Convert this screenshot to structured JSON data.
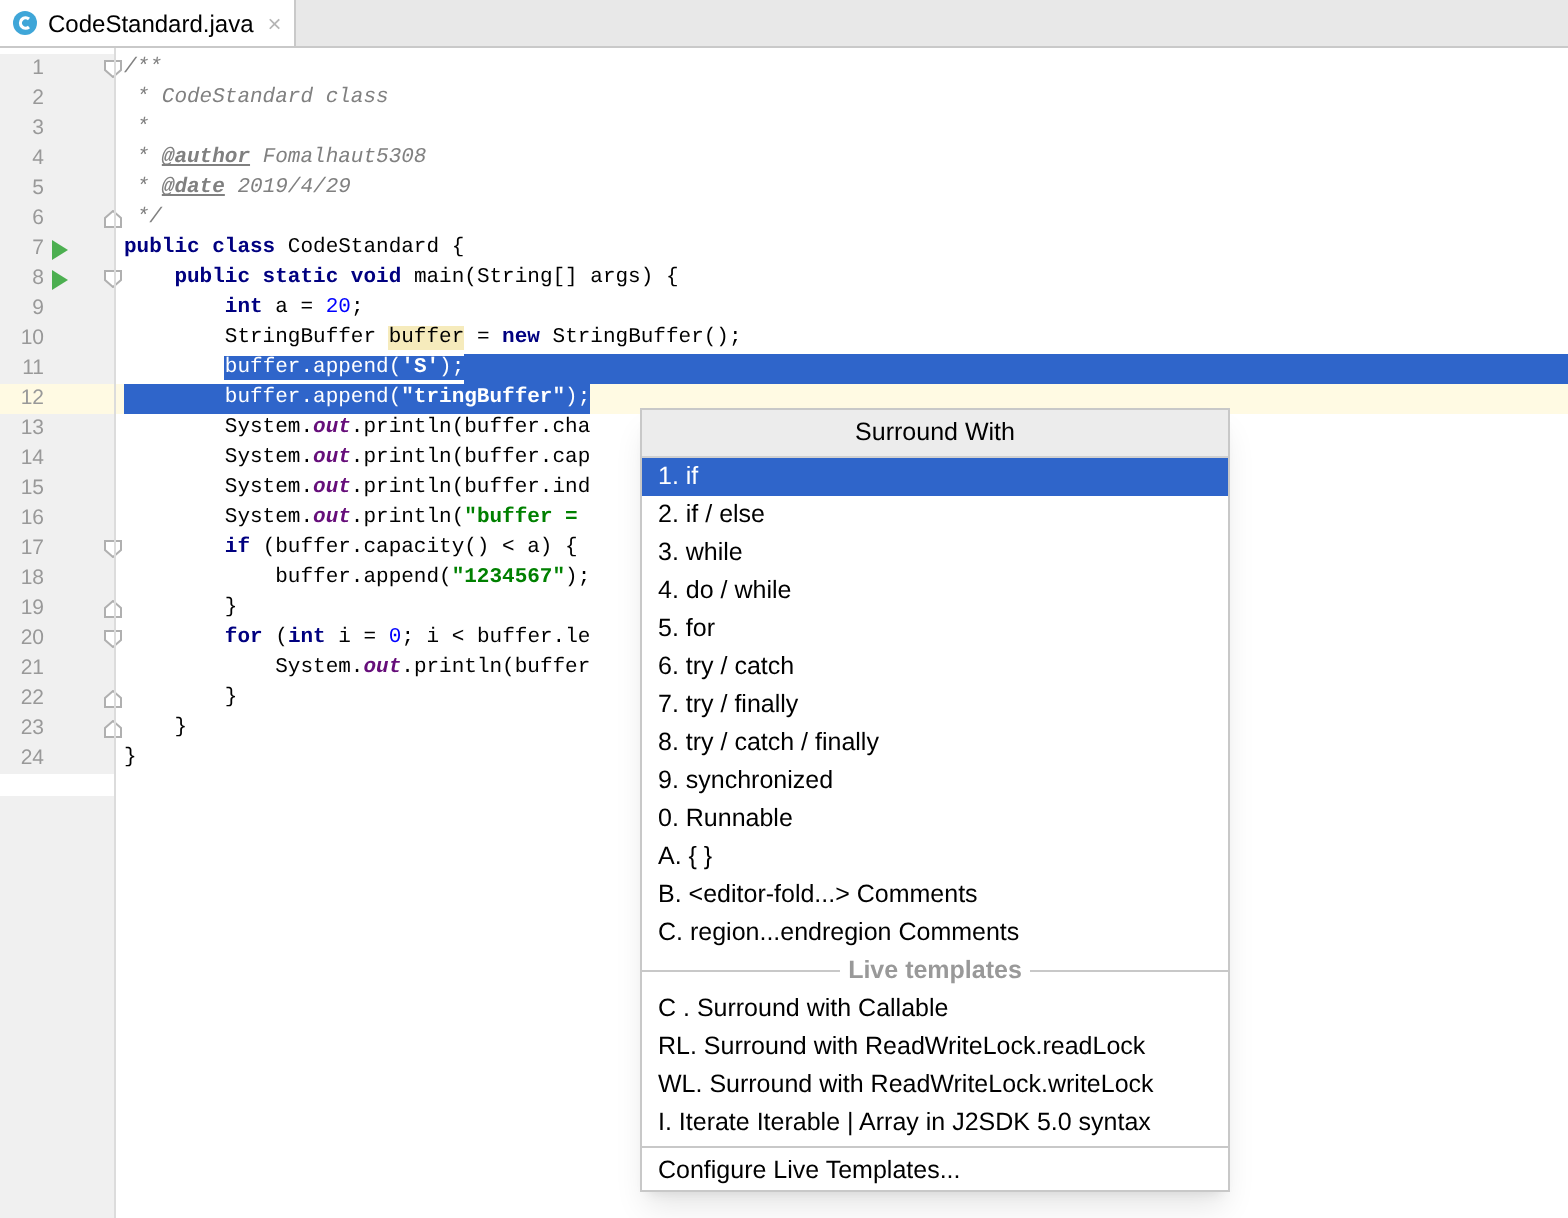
{
  "tabs": [
    {
      "label": "CodeStandard.java",
      "selected": true,
      "close": "×"
    }
  ],
  "lines": [
    {
      "n": "1",
      "run": false,
      "fold_start": true,
      "fold_end": false,
      "selected": false,
      "current": false,
      "tokens": [
        {
          "t": "/**",
          "kind": "comment"
        }
      ]
    },
    {
      "n": "2",
      "run": false,
      "fold_start": false,
      "fold_end": false,
      "selected": false,
      "current": false,
      "tokens": [
        {
          "t": " * CodeStandard class",
          "kind": "comment"
        }
      ]
    },
    {
      "n": "3",
      "run": false,
      "fold_start": false,
      "fold_end": false,
      "selected": false,
      "current": false,
      "tokens": [
        {
          "t": " *",
          "kind": "comment"
        }
      ]
    },
    {
      "n": "4",
      "run": false,
      "fold_start": false,
      "fold_end": false,
      "selected": false,
      "current": false,
      "tokens": [
        {
          "t": " * ",
          "kind": "comment"
        },
        {
          "t": "@author",
          "kind": "tag"
        },
        {
          "t": " Fomalhaut5308",
          "kind": "comment"
        }
      ]
    },
    {
      "n": "5",
      "run": false,
      "fold_start": false,
      "fold_end": false,
      "selected": false,
      "current": false,
      "tokens": [
        {
          "t": " * ",
          "kind": "comment"
        },
        {
          "t": "@date",
          "kind": "tag"
        },
        {
          "t": " 2019/4/29",
          "kind": "comment"
        }
      ]
    },
    {
      "n": "6",
      "run": false,
      "fold_start": false,
      "fold_end": true,
      "selected": false,
      "current": false,
      "tokens": [
        {
          "t": " */",
          "kind": "comment"
        }
      ]
    },
    {
      "n": "7",
      "run": true,
      "fold_start": false,
      "fold_end": false,
      "selected": false,
      "current": false,
      "tokens": [
        {
          "t": "public class ",
          "kind": "keyword"
        },
        {
          "t": "CodeStandard {",
          "kind": "plain"
        }
      ]
    },
    {
      "n": "8",
      "run": true,
      "fold_start": true,
      "fold_end": false,
      "selected": false,
      "current": false,
      "tokens": [
        {
          "t": "    public static void ",
          "kind": "keyword"
        },
        {
          "t": "main(String[] args) {",
          "kind": "plain"
        }
      ]
    },
    {
      "n": "9",
      "run": false,
      "fold_start": false,
      "fold_end": false,
      "selected": false,
      "current": false,
      "tokens": [
        {
          "t": "        int ",
          "kind": "keyword"
        },
        {
          "t": "a = ",
          "kind": "plain"
        },
        {
          "t": "20",
          "kind": "number"
        },
        {
          "t": ";",
          "kind": "plain"
        }
      ]
    },
    {
      "n": "10",
      "run": false,
      "fold_start": false,
      "fold_end": false,
      "selected": false,
      "current": false,
      "tokens": [
        {
          "t": "        StringBuffer ",
          "kind": "plain"
        },
        {
          "t": "buffer",
          "kind": "highlight"
        },
        {
          "t": " = ",
          "kind": "plain"
        },
        {
          "t": "new ",
          "kind": "keyword"
        },
        {
          "t": "StringBuffer();",
          "kind": "plain"
        }
      ]
    },
    {
      "n": "11",
      "run": false,
      "fold_start": false,
      "fold_end": false,
      "selected": true,
      "current": false,
      "tokens": [
        {
          "t": "        buffer.append(",
          "kind": "plain"
        },
        {
          "t": "'S'",
          "kind": "string"
        },
        {
          "t": ");",
          "kind": "plain"
        }
      ]
    },
    {
      "n": "12",
      "run": false,
      "fold_start": false,
      "fold_end": false,
      "selected": true,
      "current": true,
      "tokens": [
        {
          "t": "        buffer.append(",
          "kind": "plain"
        },
        {
          "t": "\"tringBuffer\"",
          "kind": "string"
        },
        {
          "t": ");",
          "kind": "plain"
        }
      ]
    },
    {
      "n": "13",
      "run": false,
      "fold_start": false,
      "fold_end": false,
      "selected": false,
      "current": false,
      "tokens": [
        {
          "t": "        System.",
          "kind": "plain"
        },
        {
          "t": "out",
          "kind": "field"
        },
        {
          "t": ".println(buffer.cha",
          "kind": "plain"
        }
      ]
    },
    {
      "n": "14",
      "run": false,
      "fold_start": false,
      "fold_end": false,
      "selected": false,
      "current": false,
      "tokens": [
        {
          "t": "        System.",
          "kind": "plain"
        },
        {
          "t": "out",
          "kind": "field"
        },
        {
          "t": ".println(buffer.cap",
          "kind": "plain"
        }
      ]
    },
    {
      "n": "15",
      "run": false,
      "fold_start": false,
      "fold_end": false,
      "selected": false,
      "current": false,
      "tokens": [
        {
          "t": "        System.",
          "kind": "plain"
        },
        {
          "t": "out",
          "kind": "field"
        },
        {
          "t": ".println(buffer.ind",
          "kind": "plain"
        }
      ]
    },
    {
      "n": "16",
      "run": false,
      "fold_start": false,
      "fold_end": false,
      "selected": false,
      "current": false,
      "tokens": [
        {
          "t": "        System.",
          "kind": "plain"
        },
        {
          "t": "out",
          "kind": "field"
        },
        {
          "t": ".println(",
          "kind": "plain"
        },
        {
          "t": "\"buffer =",
          "kind": "string"
        }
      ]
    },
    {
      "n": "17",
      "run": false,
      "fold_start": true,
      "fold_end": false,
      "selected": false,
      "current": false,
      "tokens": [
        {
          "t": "        if ",
          "kind": "keyword"
        },
        {
          "t": "(buffer.capacity() < a) {",
          "kind": "plain"
        }
      ]
    },
    {
      "n": "18",
      "run": false,
      "fold_start": false,
      "fold_end": false,
      "selected": false,
      "current": false,
      "tokens": [
        {
          "t": "            buffer.append(",
          "kind": "plain"
        },
        {
          "t": "\"1234567\"",
          "kind": "string"
        },
        {
          "t": ");",
          "kind": "plain"
        }
      ]
    },
    {
      "n": "19",
      "run": false,
      "fold_start": false,
      "fold_end": true,
      "selected": false,
      "current": false,
      "tokens": [
        {
          "t": "        }",
          "kind": "plain"
        }
      ]
    },
    {
      "n": "20",
      "run": false,
      "fold_start": true,
      "fold_end": false,
      "selected": false,
      "current": false,
      "tokens": [
        {
          "t": "        for ",
          "kind": "keyword"
        },
        {
          "t": "(",
          "kind": "plain"
        },
        {
          "t": "int ",
          "kind": "keyword"
        },
        {
          "t": "i = ",
          "kind": "plain"
        },
        {
          "t": "0",
          "kind": "number"
        },
        {
          "t": "; i < buffer.le",
          "kind": "plain"
        }
      ]
    },
    {
      "n": "21",
      "run": false,
      "fold_start": false,
      "fold_end": false,
      "selected": false,
      "current": false,
      "tokens": [
        {
          "t": "            System.",
          "kind": "plain"
        },
        {
          "t": "out",
          "kind": "field"
        },
        {
          "t": ".println(buffer",
          "kind": "plain"
        }
      ]
    },
    {
      "n": "22",
      "run": false,
      "fold_start": false,
      "fold_end": true,
      "selected": false,
      "current": false,
      "tokens": [
        {
          "t": "        }",
          "kind": "plain"
        }
      ]
    },
    {
      "n": "23",
      "run": false,
      "fold_start": false,
      "fold_end": true,
      "selected": false,
      "current": false,
      "tokens": [
        {
          "t": "    }",
          "kind": "plain"
        }
      ]
    },
    {
      "n": "24",
      "run": false,
      "fold_start": false,
      "fold_end": false,
      "selected": false,
      "current": false,
      "tokens": [
        {
          "t": "}",
          "kind": "plain"
        }
      ]
    }
  ],
  "popup": {
    "title": "Surround With",
    "items": [
      {
        "kind": "item",
        "label": "1. if",
        "selected": true
      },
      {
        "kind": "item",
        "label": "2. if / else",
        "selected": false
      },
      {
        "kind": "item",
        "label": "3. while",
        "selected": false
      },
      {
        "kind": "item",
        "label": "4. do / while",
        "selected": false
      },
      {
        "kind": "item",
        "label": "5. for",
        "selected": false
      },
      {
        "kind": "item",
        "label": "6. try / catch",
        "selected": false
      },
      {
        "kind": "item",
        "label": "7. try / finally",
        "selected": false
      },
      {
        "kind": "item",
        "label": "8. try / catch / finally",
        "selected": false
      },
      {
        "kind": "item",
        "label": "9. synchronized",
        "selected": false
      },
      {
        "kind": "item",
        "label": "0. Runnable",
        "selected": false
      },
      {
        "kind": "item",
        "label": "A. { }",
        "selected": false
      },
      {
        "kind": "item",
        "label": "B. <editor-fold...> Comments",
        "selected": false
      },
      {
        "kind": "item",
        "label": "C. region...endregion Comments",
        "selected": false
      },
      {
        "kind": "section",
        "label": "Live templates"
      },
      {
        "kind": "item",
        "label": "C . Surround with Callable",
        "selected": false
      },
      {
        "kind": "item",
        "label": "RL. Surround with ReadWriteLock.readLock",
        "selected": false
      },
      {
        "kind": "item",
        "label": "WL. Surround with ReadWriteLock.writeLock",
        "selected": false
      },
      {
        "kind": "item",
        "label": "I. Iterate Iterable | Array in J2SDK 5.0 syntax",
        "selected": false
      },
      {
        "kind": "separator"
      },
      {
        "kind": "item",
        "label": "Configure Live Templates...",
        "selected": false
      }
    ]
  }
}
